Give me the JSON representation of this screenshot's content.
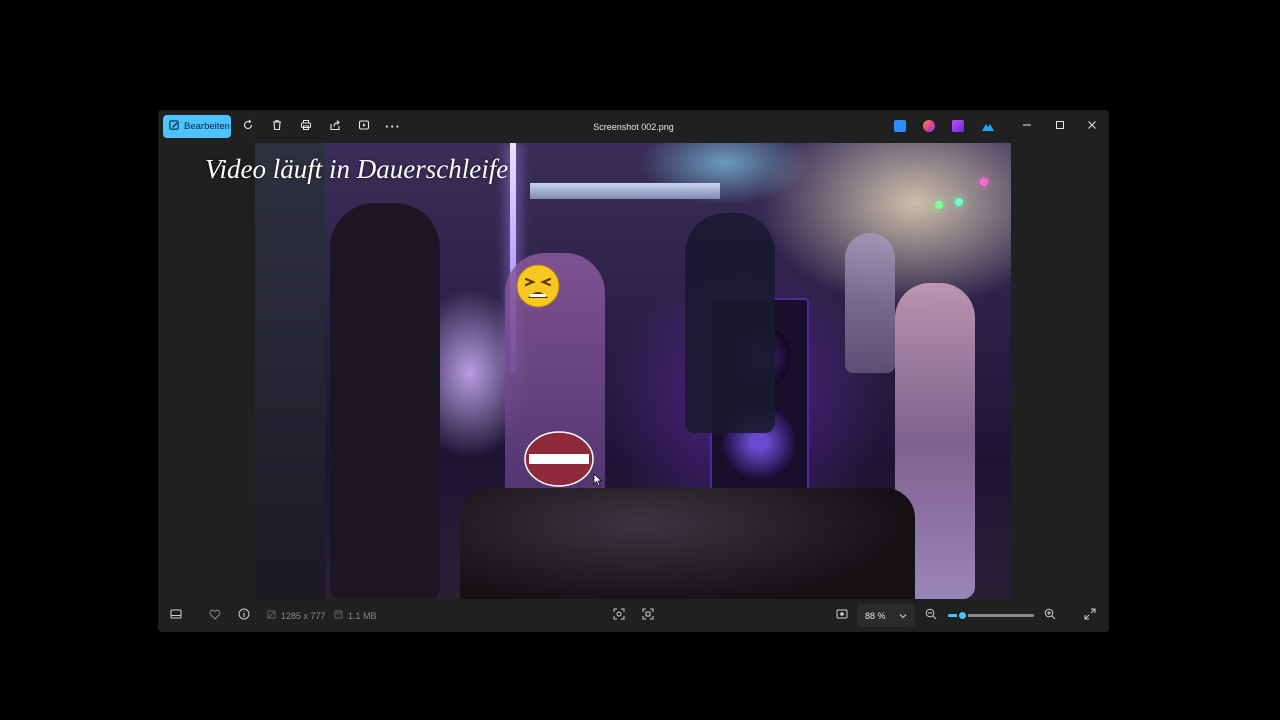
{
  "toolbar": {
    "edit_label": "Bearbeiten",
    "edit_icon": "edit-icon",
    "rotate_icon": "rotate-icon",
    "delete_icon": "trash-icon",
    "print_icon": "print-icon",
    "share_icon": "share-icon",
    "slideshow_icon": "slideshow-icon",
    "more_icon": "more-icon"
  },
  "window": {
    "title": "Screenshot 002.png",
    "controls": [
      "minimize",
      "maximize",
      "close"
    ]
  },
  "apps": [
    {
      "name": "app-icon-1",
      "color": "#2d8cff"
    },
    {
      "name": "app-icon-2",
      "color": "#e2468b"
    },
    {
      "name": "app-icon-3",
      "color": "#9b3dff"
    },
    {
      "name": "app-icon-4",
      "color": "#1ea7fd"
    }
  ],
  "viewer": {
    "overlay_caption": "Video läuft in Dauerschleife"
  },
  "statusbar": {
    "dimensions": "1285 x 777",
    "file_size": "1.1 MB",
    "zoom_value": "88 %",
    "zoom_fraction": 0.16
  },
  "colors": {
    "accent": "#4cc2ff",
    "background": "#202020"
  }
}
